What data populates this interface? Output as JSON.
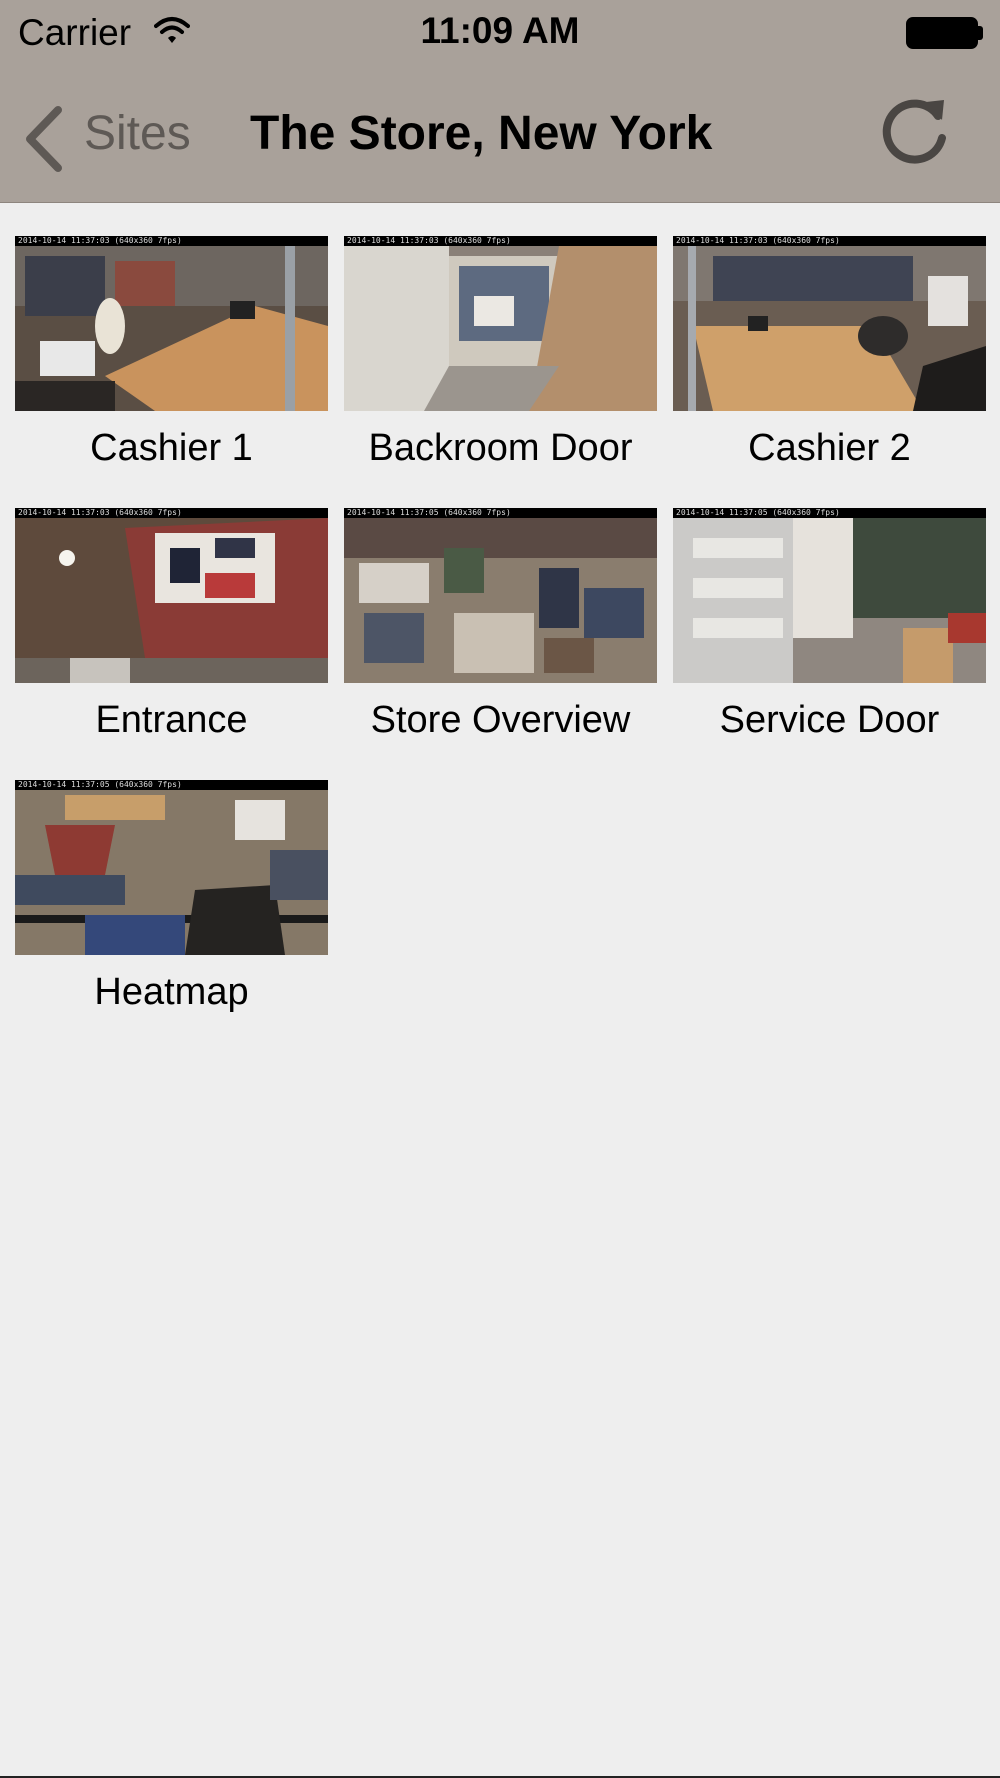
{
  "status_bar": {
    "carrier": "Carrier",
    "time": "11:09 AM",
    "wifi_icon": "wifi-icon",
    "battery_icon": "battery-icon"
  },
  "nav": {
    "back_label": "Sites",
    "title": "The Store, New York",
    "back_icon": "chevron-left-icon",
    "refresh_icon": "refresh-icon"
  },
  "cameras": [
    {
      "label": "Cashier 1",
      "timestamp": "2014-10-14 11:37:03 (640x360 7fps)"
    },
    {
      "label": "Backroom Door",
      "timestamp": "2014-10-14 11:37:03 (640x360 7fps)"
    },
    {
      "label": "Cashier 2",
      "timestamp": "2014-10-14 11:37:03 (640x360 7fps)"
    },
    {
      "label": "Entrance",
      "timestamp": "2014-10-14 11:37:03 (640x360 7fps)"
    },
    {
      "label": "Store Overview",
      "timestamp": "2014-10-14 11:37:05 (640x360 7fps)"
    },
    {
      "label": "Service Door",
      "timestamp": "2014-10-14 11:37:05 (640x360 7fps)"
    },
    {
      "label": "Heatmap",
      "timestamp": "2014-10-14 11:37:05 (640x360 7fps)"
    }
  ],
  "colors": {
    "bar_background": "#a9a19a",
    "page_background": "#eeeeee"
  }
}
